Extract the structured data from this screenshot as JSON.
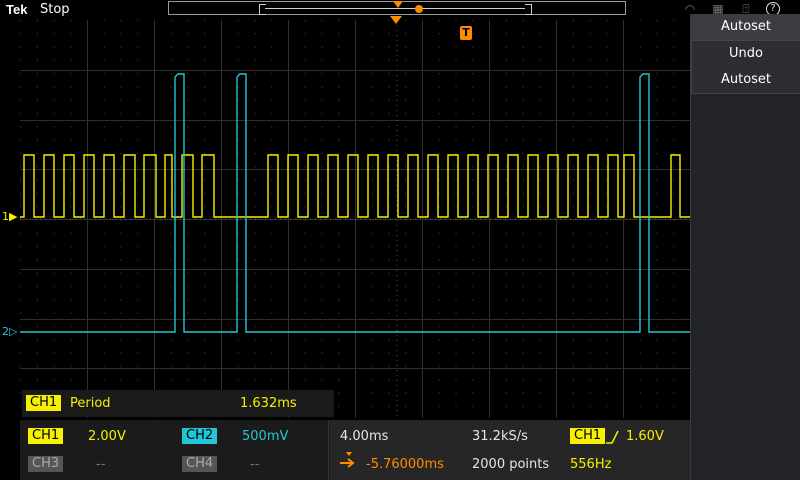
{
  "app": {
    "brand": "Tek",
    "status": "Stop"
  },
  "panel": {
    "header": "Autoset",
    "items": [
      "Undo",
      "Autoset"
    ]
  },
  "measurement": {
    "channel": "CH1",
    "name": "Period",
    "value": "1.632ms"
  },
  "channels": [
    {
      "label": "CH1",
      "scale": "2.00V"
    },
    {
      "label": "CH2",
      "scale": "500mV"
    },
    {
      "label": "CH3",
      "scale": "--"
    },
    {
      "label": "CH4",
      "scale": "--"
    }
  ],
  "horizontal": {
    "timebase": "4.00ms",
    "position": "-5.76000ms",
    "sample_rate": "31.2kS/s",
    "record": "2000 points"
  },
  "trigger": {
    "source": "CH1",
    "level": "1.60V",
    "frequency": "556Hz",
    "marker": "T"
  },
  "markers": {
    "ch1": "1",
    "ch2": "2"
  },
  "colors": {
    "ch1": "#f7f000",
    "ch2": "#23c6d6",
    "accent": "#ff8c00"
  }
}
